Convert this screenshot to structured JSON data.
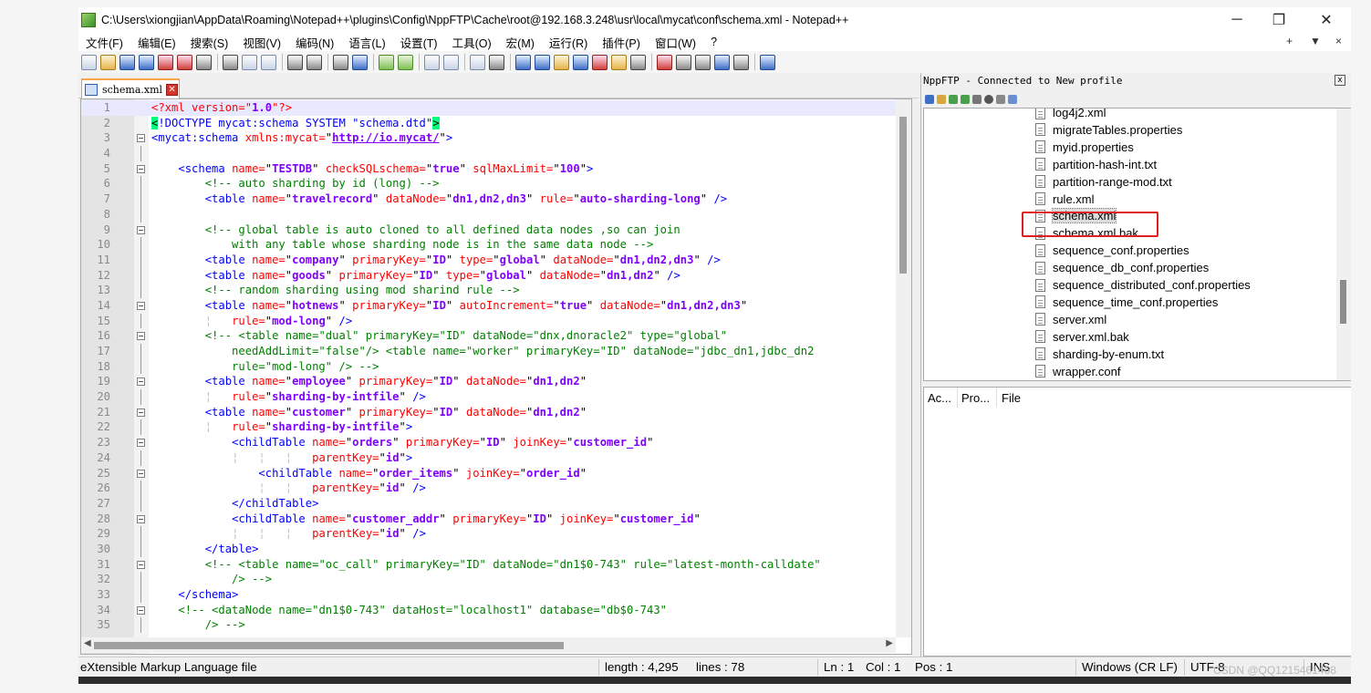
{
  "window": {
    "title": "C:\\Users\\xiongjian\\AppData\\Roaming\\Notepad++\\plugins\\Config\\NppFTP\\Cache\\root@192.168.3.248\\usr\\local\\mycat\\conf\\schema.xml - Notepad++",
    "minimize": "─",
    "restore": "❐",
    "close": "✕"
  },
  "menu": {
    "items": [
      "文件(F)",
      "编辑(E)",
      "搜索(S)",
      "视图(V)",
      "编码(N)",
      "语言(L)",
      "设置(T)",
      "工具(O)",
      "宏(M)",
      "运行(R)",
      "插件(P)",
      "窗口(W)",
      "?"
    ],
    "right_plus": "+",
    "right_down": "▼",
    "right_close": "×"
  },
  "tab": {
    "label": "schema.xml",
    "close": "✕"
  },
  "editor": {
    "language": "XML",
    "lines": [
      {
        "n": "1",
        "fold": "none",
        "html": "<span class='pi'>&lt;?xml version=\"<span class='av'>1.0</span>\"?&gt;</span>"
      },
      {
        "n": "2",
        "fold": "none",
        "html": "<span class='hl'>&lt;</span><span class='tg'>!DOCTYPE mycat:schema SYSTEM \"schema.dtd\"</span><span class='hl'>&gt;</span>"
      },
      {
        "n": "3",
        "fold": "open",
        "html": "<span class='tg'>&lt;mycat:schema</span> <span class='at'>xmlns:mycat=</span>\"<span class='vl'>http://io.mycat/</span>\"<span class='tg'>&gt;</span>"
      },
      {
        "n": "4",
        "fold": "line",
        "html": ""
      },
      {
        "n": "5",
        "fold": "open",
        "html": "    <span class='tg'>&lt;schema</span> <span class='at'>name=</span>\"<span class='av'>TESTDB</span>\" <span class='at'>checkSQLschema=</span>\"<span class='av'>true</span>\" <span class='at'>sqlMaxLimit=</span>\"<span class='av'>100</span>\"<span class='tg'>&gt;</span>"
      },
      {
        "n": "6",
        "fold": "line",
        "html": "        <span class='cm'>&lt;!-- auto sharding by id (long) --&gt;</span>"
      },
      {
        "n": "7",
        "fold": "line",
        "html": "        <span class='tg'>&lt;table</span> <span class='at'>name=</span>\"<span class='av'>travelrecord</span>\" <span class='at'>dataNode=</span>\"<span class='av'>dn1,dn2,dn3</span>\" <span class='at'>rule=</span>\"<span class='av'>auto-sharding-long</span>\" <span class='tg'>/&gt;</span>"
      },
      {
        "n": "8",
        "fold": "line",
        "html": ""
      },
      {
        "n": "9",
        "fold": "open",
        "html": "        <span class='cm'>&lt;!-- global table is auto cloned to all defined data nodes ,so can join</span>"
      },
      {
        "n": "10",
        "fold": "end",
        "html": "<span class='cm'>            with any table whose sharding node is in the same data node --&gt;</span>"
      },
      {
        "n": "11",
        "fold": "line",
        "html": "        <span class='tg'>&lt;table</span> <span class='at'>name=</span>\"<span class='av'>company</span>\" <span class='at'>primaryKey=</span>\"<span class='av'>ID</span>\" <span class='at'>type=</span>\"<span class='av'>global</span>\" <span class='at'>dataNode=</span>\"<span class='av'>dn1,dn2,dn3</span>\" <span class='tg'>/&gt;</span>"
      },
      {
        "n": "12",
        "fold": "line",
        "html": "        <span class='tg'>&lt;table</span> <span class='at'>name=</span>\"<span class='av'>goods</span>\" <span class='at'>primaryKey=</span>\"<span class='av'>ID</span>\" <span class='at'>type=</span>\"<span class='av'>global</span>\" <span class='at'>dataNode=</span>\"<span class='av'>dn1,dn2</span>\" <span class='tg'>/&gt;</span>"
      },
      {
        "n": "13",
        "fold": "line",
        "html": "        <span class='cm'>&lt;!-- random sharding using mod sharind rule --&gt;</span>"
      },
      {
        "n": "14",
        "fold": "open",
        "html": "        <span class='tg'>&lt;table</span> <span class='at'>name=</span>\"<span class='av'>hotnews</span>\" <span class='at'>primaryKey=</span>\"<span class='av'>ID</span>\" <span class='at'>autoIncrement=</span>\"<span class='av'>true</span>\" <span class='at'>dataNode=</span>\"<span class='av'>dn1,dn2,dn3</span>\""
      },
      {
        "n": "15",
        "fold": "end",
        "html": "        <span class='gd'>¦</span>   <span class='at'>rule=</span>\"<span class='av'>mod-long</span>\" <span class='tg'>/&gt;</span>"
      },
      {
        "n": "16",
        "fold": "open",
        "html": "        <span class='cm'>&lt;!-- &lt;table name=\"dual\" primaryKey=\"ID\" dataNode=\"dnx,dnoracle2\" type=\"global\"</span>"
      },
      {
        "n": "17",
        "fold": "line",
        "html": "<span class='cm'>            needAddLimit=\"false\"/&gt; &lt;table name=\"worker\" primaryKey=\"ID\" dataNode=\"jdbc_dn1,jdbc_dn2</span>"
      },
      {
        "n": "18",
        "fold": "end",
        "html": "<span class='cm'>            rule=\"mod-long\" /&gt; --&gt;</span>"
      },
      {
        "n": "19",
        "fold": "open",
        "html": "        <span class='tg'>&lt;table</span> <span class='at'>name=</span>\"<span class='av'>employee</span>\" <span class='at'>primaryKey=</span>\"<span class='av'>ID</span>\" <span class='at'>dataNode=</span>\"<span class='av'>dn1,dn2</span>\""
      },
      {
        "n": "20",
        "fold": "end",
        "html": "        <span class='gd'>¦</span>   <span class='at'>rule=</span>\"<span class='av'>sharding-by-intfile</span>\" <span class='tg'>/&gt;</span>"
      },
      {
        "n": "21",
        "fold": "open",
        "html": "        <span class='tg'>&lt;table</span> <span class='at'>name=</span>\"<span class='av'>customer</span>\" <span class='at'>primaryKey=</span>\"<span class='av'>ID</span>\" <span class='at'>dataNode=</span>\"<span class='av'>dn1,dn2</span>\""
      },
      {
        "n": "22",
        "fold": "line",
        "html": "        <span class='gd'>¦</span>   <span class='at'>rule=</span>\"<span class='av'>sharding-by-intfile</span>\"<span class='tg'>&gt;</span>"
      },
      {
        "n": "23",
        "fold": "open",
        "html": "            <span class='tg'>&lt;childTable</span> <span class='at'>name=</span>\"<span class='av'>orders</span>\" <span class='at'>primaryKey=</span>\"<span class='av'>ID</span>\" <span class='at'>joinKey=</span>\"<span class='av'>customer_id</span>\""
      },
      {
        "n": "24",
        "fold": "end",
        "html": "            <span class='gd'>¦</span>   <span class='gd'>¦</span>   <span class='gd'>¦</span>   <span class='at'>parentKey=</span>\"<span class='av'>id</span>\"<span class='tg'>&gt;</span>"
      },
      {
        "n": "25",
        "fold": "open",
        "html": "                <span class='tg'>&lt;childTable</span> <span class='at'>name=</span>\"<span class='av'>order_items</span>\" <span class='at'>joinKey=</span>\"<span class='av'>order_id</span>\""
      },
      {
        "n": "26",
        "fold": "end",
        "html": "                <span class='gd'>¦</span>   <span class='gd'>¦</span>   <span class='at'>parentKey=</span>\"<span class='av'>id</span>\" <span class='tg'>/&gt;</span>"
      },
      {
        "n": "27",
        "fold": "end",
        "html": "            <span class='tg'>&lt;/childTable&gt;</span>"
      },
      {
        "n": "28",
        "fold": "open",
        "html": "            <span class='tg'>&lt;childTable</span> <span class='at'>name=</span>\"<span class='av'>customer_addr</span>\" <span class='at'>primaryKey=</span>\"<span class='av'>ID</span>\" <span class='at'>joinKey=</span>\"<span class='av'>customer_id</span>\""
      },
      {
        "n": "29",
        "fold": "end",
        "html": "            <span class='gd'>¦</span>   <span class='gd'>¦</span>   <span class='gd'>¦</span>   <span class='at'>parentKey=</span>\"<span class='av'>id</span>\" <span class='tg'>/&gt;</span>"
      },
      {
        "n": "30",
        "fold": "end",
        "html": "        <span class='tg'>&lt;/table&gt;</span>"
      },
      {
        "n": "31",
        "fold": "open",
        "html": "        <span class='cm'>&lt;!-- &lt;table name=\"oc_call\" primaryKey=\"ID\" dataNode=\"dn1$0-743\" rule=\"latest-month-calldate\"</span>"
      },
      {
        "n": "32",
        "fold": "end",
        "html": "<span class='cm'>            /&gt; --&gt;</span>"
      },
      {
        "n": "33",
        "fold": "end",
        "html": "    <span class='tg'>&lt;/schema&gt;</span>"
      },
      {
        "n": "34",
        "fold": "open",
        "html": "    <span class='cm'>&lt;!-- &lt;dataNode name=\"dn1$0-743\" dataHost=\"localhost1\" database=\"db$0-743\"</span>"
      },
      {
        "n": "35",
        "fold": "end",
        "html": "<span class='cm'>        /&gt; --&gt;</span>"
      }
    ]
  },
  "ftp": {
    "header": "NppFTP - Connected to New profile",
    "close": "x",
    "files": [
      "log4j2.xml",
      "migrateTables.properties",
      "myid.properties",
      "partition-hash-int.txt",
      "partition-range-mod.txt",
      "rule.xml",
      "schema.xml",
      "schema.xml.bak",
      "sequence_conf.properties",
      "sequence_db_conf.properties",
      "sequence_distributed_conf.properties",
      "sequence_time_conf.properties",
      "server.xml",
      "server.xml.bak",
      "sharding-by-enum.txt",
      "wrapper.conf"
    ],
    "selected_file": "schema.xml",
    "queue_headers": [
      "Ac...",
      "Pro...",
      "File"
    ]
  },
  "status": {
    "filetype": "eXtensible Markup Language file",
    "length": "length : 4,295",
    "lines": "lines : 78",
    "ln": "Ln : 1",
    "col": "Col : 1",
    "pos": "Pos : 1",
    "eol": "Windows (CR LF)",
    "encoding": "UTF-8",
    "mode": "INS"
  },
  "watermark": "CSDN @QQ1215461468",
  "colors": {
    "highlight_box": "#e02020",
    "tab_accent": "#f7a44a"
  }
}
